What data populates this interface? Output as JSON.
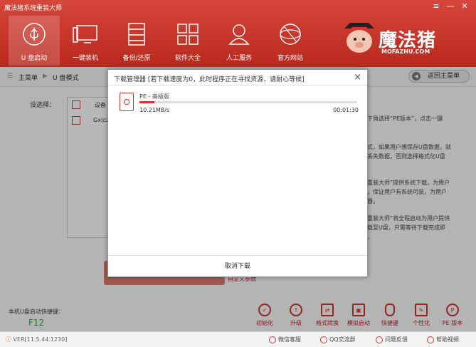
{
  "app": {
    "title": "魔法猪系统重装大师",
    "logo_text": "魔法猪",
    "logo_sub": "MOFAZHU.COM"
  },
  "nav": [
    {
      "label": "U 盘启动",
      "icon": "usb-icon",
      "active": true
    },
    {
      "label": "一键装机",
      "icon": "monitor-icon"
    },
    {
      "label": "备份/还原",
      "icon": "backup-icon"
    },
    {
      "label": "软件大全",
      "icon": "grid-icon"
    },
    {
      "label": "人工服务",
      "icon": "person-icon"
    },
    {
      "label": "官方网站",
      "icon": "globe-icon"
    }
  ],
  "breadcrumb": {
    "root": "主菜单",
    "sep": "▶",
    "current": "U 盘模式",
    "back": "返回主菜单"
  },
  "device": {
    "label": "设选择：",
    "col": "设备",
    "row": "Gx|cz"
  },
  "side_text": {
    "p1": "下角选择“PE版本”，点击一键",
    "p2": "式，如果用户想保存U盘数据，就",
    "p3": "丢失数据，否则选择格式化U盘",
    "p4": "重装大师”提供系统下载，为用户",
    "p5": "，保证用户有系统可装，为用户",
    "p6": "器。",
    "p7": "重装大师”将全程启动为用户提供",
    "p8": "载至U盘，只需等待下载完成即",
    "p9": "。"
  },
  "custom_link": "自定义参数",
  "hotkey": {
    "label": "本机U盘启动快捷键：",
    "key": "F12"
  },
  "tools": [
    {
      "label": "初始化",
      "icon": "init-icon"
    },
    {
      "label": "升级",
      "icon": "upgrade-icon"
    },
    {
      "label": "格式转换",
      "icon": "convert-icon"
    },
    {
      "label": "模拟启动",
      "icon": "simulate-icon"
    },
    {
      "label": "快捷键",
      "icon": "mouse-icon"
    },
    {
      "label": "个性化",
      "icon": "brush-icon"
    },
    {
      "label": "PE 版本",
      "icon": "pe-icon"
    }
  ],
  "footer": {
    "version": "VER[11.5.44.1230]",
    "wechat": "微信客服",
    "qq": "QQ交流群",
    "feedback": "问题反馈",
    "help": "帮助视频"
  },
  "modal": {
    "title": "下载管理器 [若下载速度为0，此时程序正在寻找资源，请耐心等候]",
    "item_name": "PE - 高级版",
    "speed": "10.21MB/s",
    "time": "00:01:30",
    "progress": 0.07,
    "cancel": "取消下载"
  },
  "colors": {
    "brand": "#c8372c",
    "progress": "#dd3333",
    "hotkey": "#33aa33"
  }
}
